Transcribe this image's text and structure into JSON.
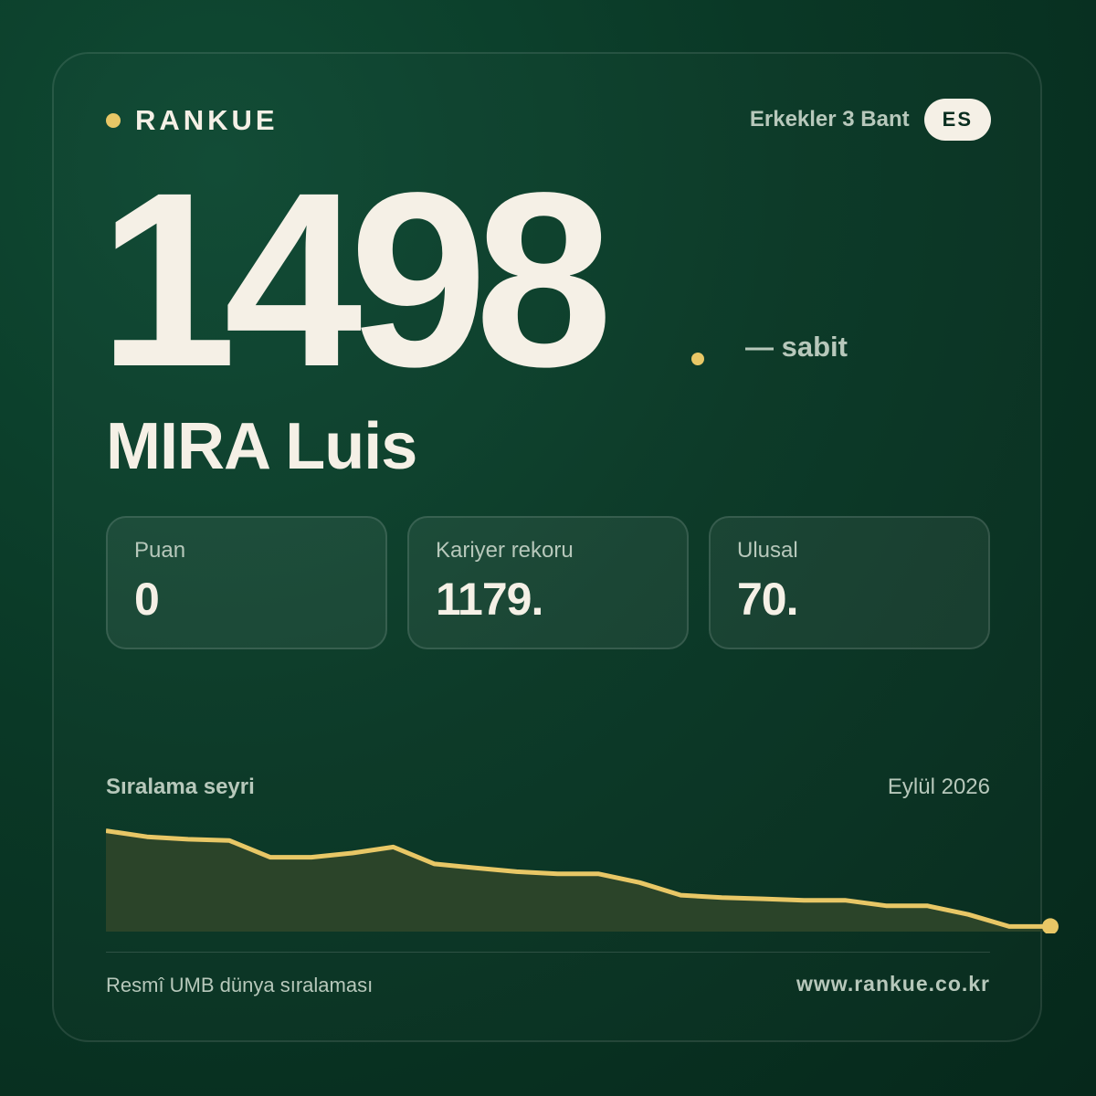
{
  "brand": {
    "name": "RANKUE"
  },
  "header": {
    "category": "Erkekler 3 Bant",
    "country_code": "ES"
  },
  "ranking": {
    "position": "1498",
    "change": "— sabit"
  },
  "player": {
    "name": "MIRA Luis"
  },
  "stats": [
    {
      "label": "Puan",
      "value": "0"
    },
    {
      "label": "Kariyer rekoru",
      "value": "1179."
    },
    {
      "label": "Ulusal",
      "value": "70."
    }
  ],
  "trend": {
    "title": "Sıralama seyri",
    "date": "Eylül 2026"
  },
  "chart_data": {
    "type": "area",
    "title": "Sıralama seyri",
    "series": [
      {
        "values": [
          1180,
          1200,
          1208,
          1212,
          1268,
          1268,
          1254,
          1234,
          1290,
          1303,
          1316,
          1323,
          1323,
          1352,
          1394,
          1402,
          1406,
          1411,
          1411,
          1429,
          1429,
          1458,
          1498,
          1498
        ]
      }
    ],
    "ylim": [
      1090,
      1515
    ],
    "inverted_y": true,
    "grid": false,
    "colors": {
      "line": "#e8c766",
      "fill": "#2b4429"
    }
  },
  "footer": {
    "source": "Resmî UMB dünya sıralaması",
    "url": "www.rankue.co.kr"
  }
}
